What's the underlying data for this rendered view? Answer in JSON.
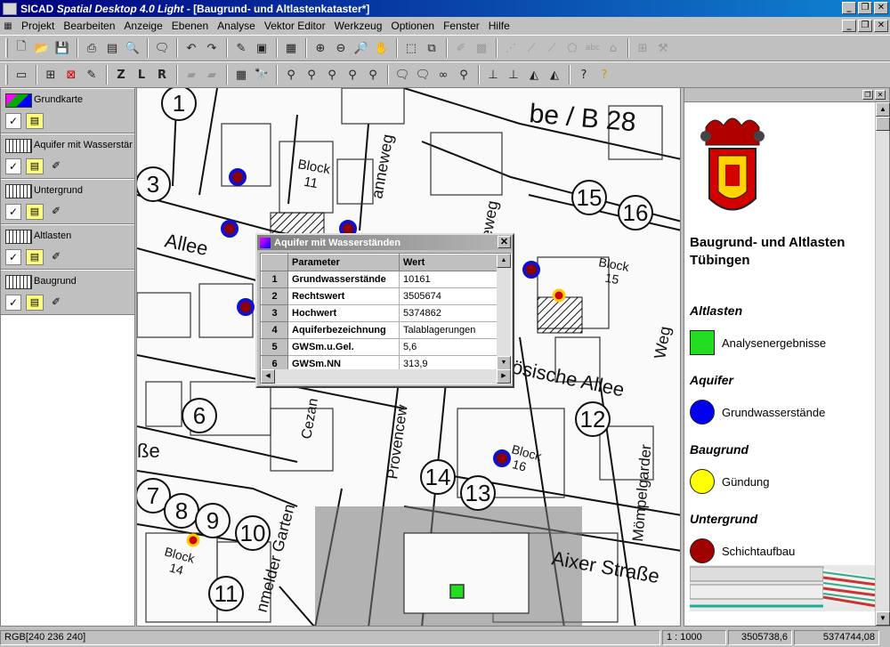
{
  "window": {
    "app_name": "SICAD",
    "app_product": "Spatial Desktop 4.0 Light",
    "doc_title": "[Baugrund- und Altlastenkataster*]"
  },
  "menu": [
    "Projekt",
    "Bearbeiten",
    "Anzeige",
    "Ebenen",
    "Analyse",
    "Vektor Editor",
    "Werkzeug",
    "Optionen",
    "Fenster",
    "Hilfe"
  ],
  "layers": [
    {
      "name": "Grundkarte"
    },
    {
      "name": "Aquifer mit Wasserstär"
    },
    {
      "name": "Untergrund"
    },
    {
      "name": "Altlasten"
    },
    {
      "name": "Baugrund"
    }
  ],
  "map_labels": {
    "b28": "be / B 28",
    "block11": "Block\n11",
    "block15": "Block\n15",
    "block16": "Block\n16",
    "block14": "Block\n14",
    "allee_left": "Allee",
    "allee_right": "ösische Allee",
    "anneweg": "anneweg",
    "eweg": "eweg",
    "weg": "Weg",
    "cezan": "Cezan",
    "provence": "Provencew",
    "moempel": "Mömpelgarder",
    "aixer": "Aixer Straße",
    "garten": "nmelder Garten",
    "sse": "ße",
    "numbers": [
      "1",
      "3",
      "15",
      "16",
      "12",
      "6",
      "14",
      "13",
      "7",
      "8",
      "9",
      "10",
      "11"
    ]
  },
  "dialog": {
    "title": "Aquifer mit Wasserständen",
    "col_param": "Parameter",
    "col_value": "Wert",
    "rows": [
      {
        "n": "1",
        "param": "Grundwasserstände",
        "value": "10161"
      },
      {
        "n": "2",
        "param": "Rechtswert",
        "value": "3505674"
      },
      {
        "n": "3",
        "param": "Hochwert",
        "value": "5374862"
      },
      {
        "n": "4",
        "param": "Aquiferbezeichnung",
        "value": "Talablagerungen"
      },
      {
        "n": "5",
        "param": "GWSm.u.Gel.",
        "value": "5,6"
      },
      {
        "n": "6",
        "param": "GWSm.NN",
        "value": "313,9"
      }
    ]
  },
  "legend": {
    "title": "Baugrund- und Altlasten Tübingen",
    "sections": [
      {
        "heading": "Altlasten",
        "item": "Analysenergebnisse",
        "color": "#22dd22",
        "shape": "square"
      },
      {
        "heading": "Aquifer",
        "item": "Grundwasserstände",
        "color": "#0000ee",
        "shape": "circle"
      },
      {
        "heading": "Baugrund",
        "item": "Gündung",
        "color": "#ffff00",
        "shape": "circle"
      },
      {
        "heading": "Untergrund",
        "item": "Schichtaufbau",
        "color": "#a00000",
        "shape": "circle"
      }
    ]
  },
  "status": {
    "rgb": "RGB[240 236 240]",
    "scale": "1 : 1000",
    "x": "3505738,6",
    "y": "5374744,08"
  }
}
